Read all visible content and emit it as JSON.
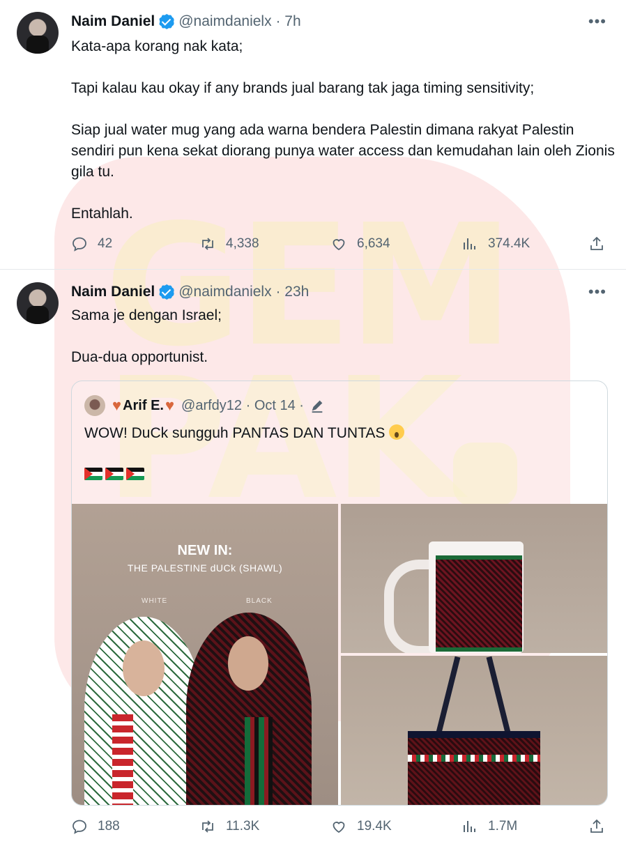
{
  "watermark": {
    "top": "GEM",
    "bottom": "PAK"
  },
  "tweets": [
    {
      "name": "Naim Daniel",
      "handle": "@naimdanielx",
      "time": "7h",
      "more": "•••",
      "paragraphs": [
        "Kata-apa korang nak kata;",
        "Tapi kalau kau okay if any brands jual barang tak jaga timing sensitivity;",
        "Siap jual water mug yang ada warna bendera Palestin dimana rakyat Palestin sendiri pun kena sekat diorang punya water access dan kemudahan lain oleh Zionis gila tu.",
        "Entahlah."
      ],
      "stats": {
        "replies": "42",
        "reposts": "4,338",
        "likes": "6,634",
        "views": "374.4K"
      }
    },
    {
      "name": "Naim Daniel",
      "handle": "@naimdanielx",
      "time": "23h",
      "more": "•••",
      "paragraphs": [
        "Sama je dengan Israel;",
        "Dua-dua opportunist."
      ],
      "stats": {
        "replies": "188",
        "reposts": "11.3K",
        "likes": "19.4K",
        "views": "1.7M"
      },
      "quote": {
        "name": "Arif E.",
        "handle": "@arfdy12",
        "time": "Oct 14",
        "text": "WOW! DuCk sungguh PANTAS DAN TUNTAS",
        "media": {
          "headline": "NEW IN:",
          "subheadline": "THE PALESTINE dUCk (SHAWL)",
          "label_white": "WHITE",
          "label_black": "BLACK"
        }
      }
    }
  ],
  "colors": {
    "text": "#0f1419",
    "muted": "#536471",
    "verified": "#1d9bf0",
    "border": "#cfd9de"
  }
}
